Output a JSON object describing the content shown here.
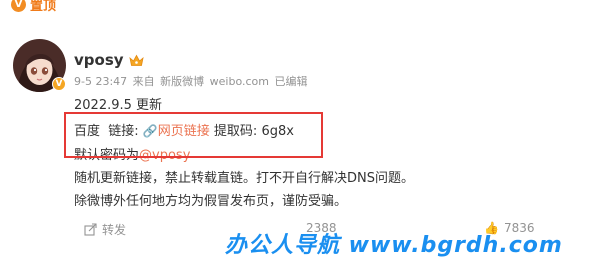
{
  "pin": {
    "label": "置顶"
  },
  "user": {
    "name": "vposy",
    "verified_badge": "V"
  },
  "meta": {
    "time": "9-5 23:47",
    "source_prefix": "来自",
    "client": "新版微博",
    "site": "weibo.com",
    "edited": "已编辑"
  },
  "post": {
    "line1": "2022.9.5 更新",
    "baidu_label": "百度",
    "link_label": "链接:",
    "link_icon": "🔗",
    "link_text": "网页链接",
    "code_label": "提取码:",
    "code_value": "6g8x",
    "password_prefix": "默认密码为",
    "password_value": "@vposy",
    "notice1": "随机更新链接，禁止转载直链。打不开自行解决DNS问题。",
    "notice2": "除微博外任何地方均为假冒发布页，谨防受骗。"
  },
  "actions": {
    "repost": "转发",
    "comments": "2388",
    "likes": "7836"
  },
  "watermark": "办公人导航 www.bgrdh.com",
  "colors": {
    "accent": "#eb7350",
    "highlight_border": "#e53935",
    "watermark": "#1a8ff0"
  }
}
